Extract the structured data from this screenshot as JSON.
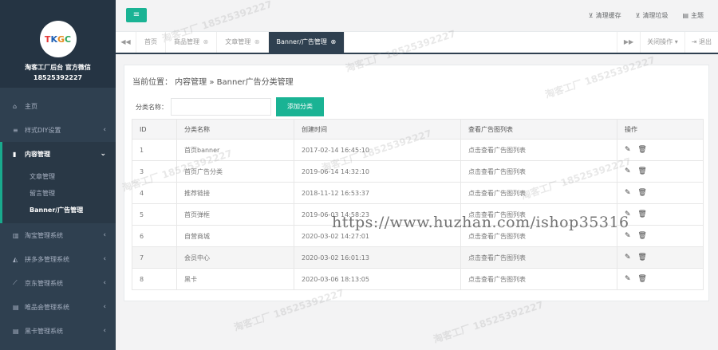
{
  "sidebar": {
    "logo_text": "TKGC",
    "brand": "淘客工厂后台 官方微信",
    "phone": "18525392227",
    "nav": [
      {
        "icon": "home-icon",
        "glyph": "⌂",
        "label": "主页"
      },
      {
        "icon": "list-icon",
        "glyph": "≡",
        "label": "样式DIY设置"
      },
      {
        "icon": "file-icon",
        "glyph": "▮",
        "label": "内容管理"
      },
      {
        "icon": "chart-icon",
        "glyph": "▥",
        "label": "淘宝管理系统"
      },
      {
        "icon": "area-chart-icon",
        "glyph": "◭",
        "label": "拼多多管理系统"
      },
      {
        "icon": "line-chart-icon",
        "glyph": "⟋",
        "label": "京东管理系统"
      },
      {
        "icon": "bar-chart-icon",
        "glyph": "▤",
        "label": "唯品会管理系统"
      },
      {
        "icon": "bar-chart-icon",
        "glyph": "▤",
        "label": "黑卡管理系统"
      }
    ],
    "sub": [
      "文章管理",
      "留言管理",
      "Banner/广告管理"
    ]
  },
  "topbar": {
    "links": [
      "清理缓存",
      "清理垃圾",
      "主题"
    ]
  },
  "tabs": {
    "items": [
      "首页",
      "商品管理",
      "文章管理",
      "Banner/广告管理"
    ],
    "close_ops": "关闭操作",
    "exit": "退出"
  },
  "content": {
    "breadcrumb": "当前位置： 内容管理 » Banner广告分类管理",
    "search_label": "分类名称：",
    "search_value": "",
    "add_button": "添加分类",
    "columns": [
      "ID",
      "分类名称",
      "创建时间",
      "查看广告图列表",
      "操作"
    ],
    "rows": [
      {
        "id": "1",
        "name": "首页banner",
        "time": "2017-02-14 16:45:10",
        "link": "点击查看广告图列表"
      },
      {
        "id": "3",
        "name": "首页广告分类",
        "time": "2019-06-14 14:32:10",
        "link": "点击查看广告图列表"
      },
      {
        "id": "4",
        "name": "推荐链接",
        "time": "2018-11-12 16:53:37",
        "link": "点击查看广告图列表"
      },
      {
        "id": "5",
        "name": "首页弹框",
        "time": "2019-06-03 14:58:23",
        "link": "点击查看广告图列表"
      },
      {
        "id": "6",
        "name": "自营商城",
        "time": "2020-03-02 14:27:01",
        "link": "点击查看广告图列表"
      },
      {
        "id": "7",
        "name": "会员中心",
        "time": "2020-03-02 16:01:13",
        "link": "点击查看广告图列表"
      },
      {
        "id": "8",
        "name": "黑卡",
        "time": "2020-03-06 18:13:05",
        "link": "点击查看广告图列表"
      }
    ]
  },
  "watermark": {
    "url": "https://www.huzhan.com/ishop35316",
    "text": "淘客工厂 18525392227"
  },
  "colors": {
    "sidebar": "#2f4050",
    "accent": "#1ab394"
  }
}
